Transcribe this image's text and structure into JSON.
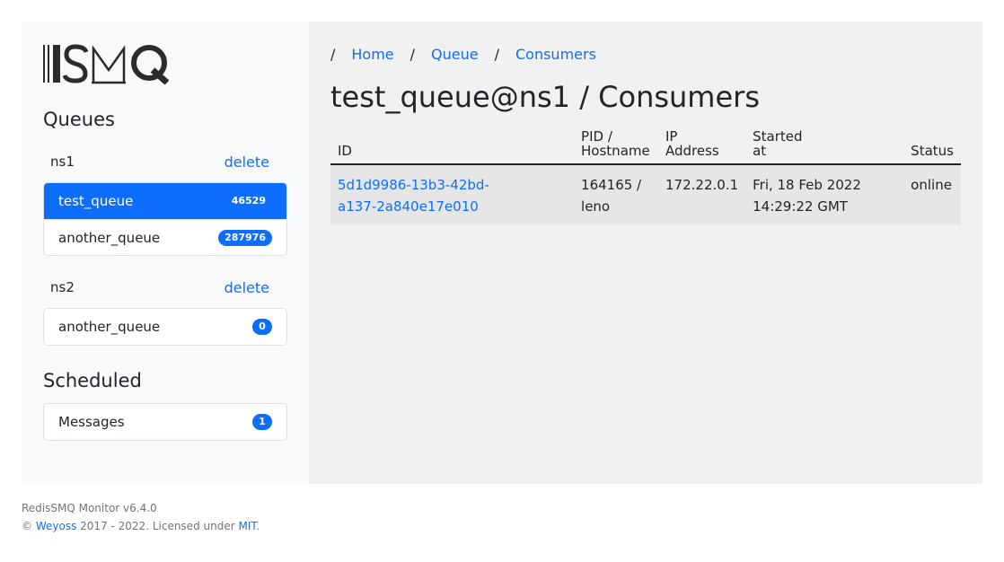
{
  "app": {
    "logo_text": "ISMQ"
  },
  "sidebar": {
    "queues_title": "Queues",
    "namespaces": [
      {
        "name": "ns1",
        "delete_label": "delete",
        "queues": [
          {
            "name": "test_queue",
            "count": "46529",
            "active": true
          },
          {
            "name": "another_queue",
            "count": "287976",
            "active": false
          }
        ]
      },
      {
        "name": "ns2",
        "delete_label": "delete",
        "queues": [
          {
            "name": "another_queue",
            "count": "0",
            "active": false
          }
        ]
      }
    ],
    "scheduled_title": "Scheduled",
    "scheduled_items": [
      {
        "name": "Messages",
        "count": "1"
      }
    ]
  },
  "breadcrumb": {
    "separator": "/",
    "items": [
      "Home",
      "Queue",
      "Consumers"
    ]
  },
  "main": {
    "title": "test_queue@ns1 / Consumers",
    "table": {
      "headers": [
        "ID",
        "PID / Hostname",
        "IP Address",
        "Started at",
        "Status"
      ],
      "rows": [
        {
          "id": "5d1d9986-13b3-42bd-a137-2a840e17e010",
          "id_line1": "5d1d9986-13b3-42bd-",
          "id_line2": "a137-2a840e17e010",
          "pid_line1": "164165 /",
          "pid_line2": "leno",
          "ip": "172.22.0.1",
          "started_line1": "Fri, 18 Feb 2022",
          "started_line2": "14:29:22 GMT",
          "status": "online"
        }
      ]
    }
  },
  "footer": {
    "version": "RedisSMQ Monitor v6.4.0",
    "copyright_prefix": "©",
    "author": "Weyoss",
    "years": "2017 - 2022. Licensed under",
    "license": "MIT",
    "suffix": "."
  },
  "colors": {
    "accent": "#0d6efd",
    "sidebar_bg": "#f8f9fa",
    "main_bg": "#f1f1f1"
  }
}
